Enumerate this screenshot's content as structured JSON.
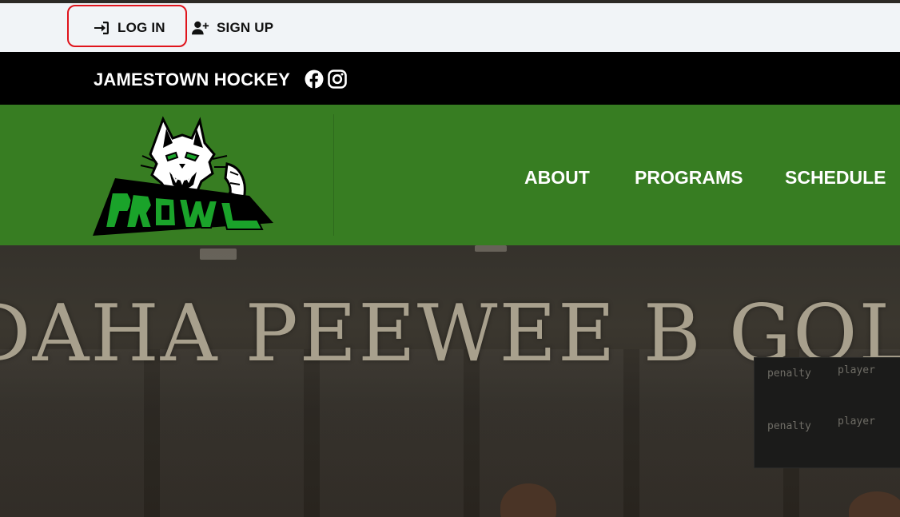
{
  "utility": {
    "login_label": "LOG IN",
    "signup_label": "SIGN UP",
    "login_icon": "sign-in-icon",
    "signup_icon": "user-plus-icon",
    "highlight_color": "#e0141c"
  },
  "org": {
    "name": "JAMESTOWN HOCKEY",
    "social": [
      "facebook-icon",
      "instagram-icon"
    ]
  },
  "nav": {
    "logo_text": "PROWL",
    "items": [
      "ABOUT",
      "PROGRAMS",
      "SCHEDULE"
    ],
    "bar_color": "#377d22"
  },
  "hero": {
    "title": "DAHA PEEWEE B GOLD",
    "scoreboard": {
      "labels": [
        "penalty",
        "player",
        "penalty",
        "player"
      ]
    }
  }
}
